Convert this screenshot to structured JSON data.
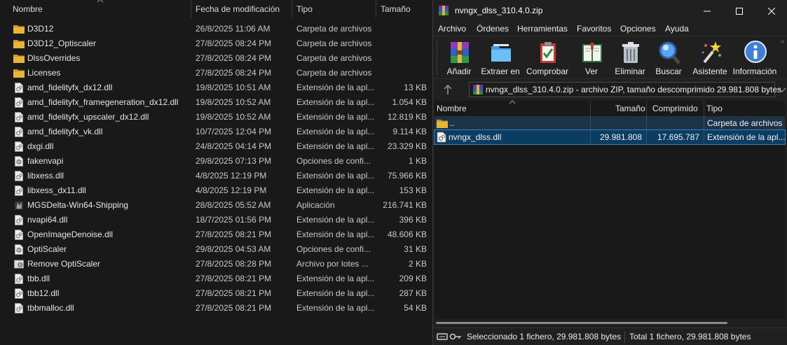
{
  "explorer": {
    "columns": {
      "name": "Nombre",
      "date": "Fecha de modificación",
      "type": "Tipo",
      "size": "Tamaño"
    },
    "files": [
      {
        "name": "D3D12",
        "date": "26/8/2025 11:06 AM",
        "type": "Carpeta de archivos",
        "size": "",
        "icon": "folder-icon"
      },
      {
        "name": "D3D12_Optiscaler",
        "date": "27/8/2025 08:24 PM",
        "type": "Carpeta de archivos",
        "size": "",
        "icon": "folder-icon"
      },
      {
        "name": "DlssOverrides",
        "date": "27/8/2025 08:24 PM",
        "type": "Carpeta de archivos",
        "size": "",
        "icon": "folder-icon"
      },
      {
        "name": "Licenses",
        "date": "27/8/2025 08:24 PM",
        "type": "Carpeta de archivos",
        "size": "",
        "icon": "folder-icon"
      },
      {
        "name": "amd_fidelityfx_dx12.dll",
        "date": "19/8/2025 10:51 AM",
        "type": "Extensión de la apl...",
        "size": "13 KB",
        "icon": "dll-file-icon"
      },
      {
        "name": "amd_fidelityfx_framegeneration_dx12.dll",
        "date": "19/8/2025 10:52 AM",
        "type": "Extensión de la apl...",
        "size": "1.054 KB",
        "icon": "dll-file-icon"
      },
      {
        "name": "amd_fidelityfx_upscaler_dx12.dll",
        "date": "19/8/2025 10:52 AM",
        "type": "Extensión de la apl...",
        "size": "12.819 KB",
        "icon": "dll-file-icon"
      },
      {
        "name": "amd_fidelityfx_vk.dll",
        "date": "10/7/2025 12:04 PM",
        "type": "Extensión de la apl...",
        "size": "9.114 KB",
        "icon": "dll-file-icon"
      },
      {
        "name": "dxgi.dll",
        "date": "24/8/2025 04:14 PM",
        "type": "Extensión de la apl...",
        "size": "23.329 KB",
        "icon": "dll-file-icon"
      },
      {
        "name": "fakenvapi",
        "date": "29/8/2025 07:13 PM",
        "type": "Opciones de confi...",
        "size": "1 KB",
        "icon": "config-file-icon"
      },
      {
        "name": "libxess.dll",
        "date": "4/8/2025 12:19 PM",
        "type": "Extensión de la apl...",
        "size": "75.966 KB",
        "icon": "dll-file-icon"
      },
      {
        "name": "libxess_dx11.dll",
        "date": "4/8/2025 12:19 PM",
        "type": "Extensión de la apl...",
        "size": "153 KB",
        "icon": "dll-file-icon"
      },
      {
        "name": "MGSDelta-Win64-Shipping",
        "date": "28/8/2025 05:52 AM",
        "type": "Aplicación",
        "size": "216.741 KB",
        "icon": "application-icon"
      },
      {
        "name": "nvapi64.dll",
        "date": "18/7/2025 01:56 PM",
        "type": "Extensión de la apl...",
        "size": "396 KB",
        "icon": "dll-file-icon"
      },
      {
        "name": "OpenImageDenoise.dll",
        "date": "27/8/2025 08:21 PM",
        "type": "Extensión de la apl...",
        "size": "48.606 KB",
        "icon": "dll-file-icon"
      },
      {
        "name": "OptiScaler",
        "date": "29/8/2025 04:53 AM",
        "type": "Opciones de confi...",
        "size": "31 KB",
        "icon": "config-file-icon"
      },
      {
        "name": "Remove OptiScaler",
        "date": "27/8/2025 08:28 PM",
        "type": "Archivo por lotes ...",
        "size": "2 KB",
        "icon": "batch-file-icon"
      },
      {
        "name": "tbb.dll",
        "date": "27/8/2025 08:21 PM",
        "type": "Extensión de la apl...",
        "size": "209 KB",
        "icon": "dll-file-icon"
      },
      {
        "name": "tbb12.dll",
        "date": "27/8/2025 08:21 PM",
        "type": "Extensión de la apl...",
        "size": "287 KB",
        "icon": "dll-file-icon"
      },
      {
        "name": "tbbmalloc.dll",
        "date": "27/8/2025 08:21 PM",
        "type": "Extensión de la apl...",
        "size": "54 KB",
        "icon": "dll-file-icon"
      }
    ]
  },
  "winrar": {
    "title": "nvngx_dlss_310.4.0.zip",
    "menu": [
      "Archivo",
      "Órdenes",
      "Herramientas",
      "Favoritos",
      "Opciones",
      "Ayuda"
    ],
    "toolbar": [
      {
        "label": "Añadir",
        "icon": "add-archive-icon"
      },
      {
        "label": "Extraer en",
        "icon": "extract-folder-icon"
      },
      {
        "label": "Comprobar",
        "icon": "test-clipboard-icon"
      },
      {
        "label": "Ver",
        "icon": "view-book-icon"
      },
      {
        "label": "Eliminar",
        "icon": "trash-icon"
      },
      {
        "label": "Buscar",
        "icon": "find-magnifier-icon"
      },
      {
        "label": "Asistente",
        "icon": "wizard-wand-icon"
      },
      {
        "label": "Información",
        "icon": "info-icon"
      }
    ],
    "address": "nvngx_dlss_310.4.0.zip - archivo ZIP, tamaño descomprimido 29.981.808 bytes",
    "columns": {
      "name": "Nombre",
      "size": "Tamaño",
      "packed": "Comprimido",
      "type": "Tipo"
    },
    "rows": [
      {
        "name": "..",
        "size": "",
        "packed": "",
        "type": "Carpeta de archivos",
        "icon": "folder-icon"
      },
      {
        "name": "nvngx_dlss.dll",
        "size": "29.981.808",
        "packed": "17.695.787",
        "type": "Extensión de la apl...",
        "icon": "dll-file-icon",
        "selected": true
      }
    ],
    "status_selected": "Seleccionado 1 fichero, 29.981.808 bytes",
    "status_total": "Total 1 fichero, 29.981.808 bytes"
  },
  "colors": {
    "background": "#191919",
    "folder": "#e8b53a",
    "selection": "#0b3d63",
    "selection_border": "#3a7fc0"
  }
}
